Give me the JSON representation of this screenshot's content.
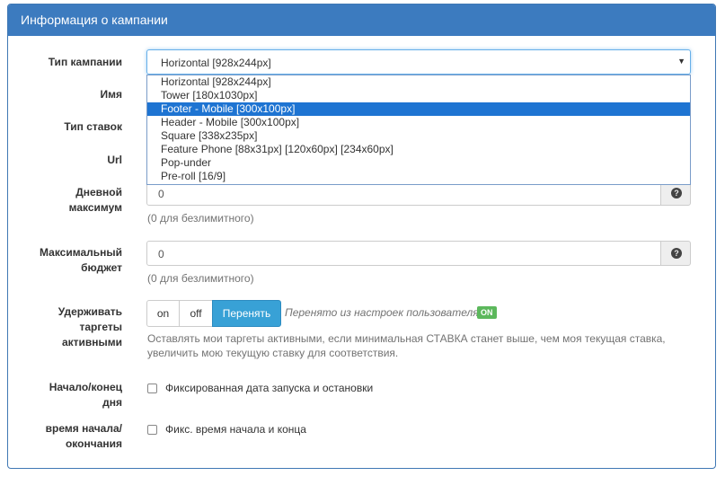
{
  "panel": {
    "title": "Информация о кампании"
  },
  "labels": {
    "campaign_type": "Тип кампании",
    "name": "Имя",
    "bid_type": "Тип ставок",
    "url": "Url",
    "daily_max_1": "Дневной",
    "daily_max_2": "максимум",
    "max_budget_1": "Максимальный",
    "max_budget_2": "бюджет",
    "keep_targets_1": "Удерживать",
    "keep_targets_2": "таргеты",
    "keep_targets_3": "активными",
    "start_end_1": "Начало/конец",
    "start_end_2": "дня",
    "time_1": "время начала/",
    "time_2": "окончания"
  },
  "campaign_type": {
    "selected": "Horizontal [928x244px]",
    "options": [
      "Horizontal [928x244px]",
      "Tower [180x1030px]",
      "Footer - Mobile [300x100px]",
      "Header - Mobile [300x100px]",
      "Square [338x235px]",
      "Feature Phone [88x31px] [120x60px] [234x60px]",
      "Pop-under",
      "Pre-roll [16/9]"
    ],
    "highlighted_index": 2,
    "caret": "▼"
  },
  "daily_max": {
    "value": "0",
    "help": "(0 для безлимитного)",
    "icon": "question-icon",
    "icon_glyph": "?"
  },
  "max_budget": {
    "value": "0",
    "help": "(0 для безлимитного)",
    "icon": "question-icon",
    "icon_glyph": "?"
  },
  "keep_targets": {
    "options": [
      "on",
      "off",
      "Перенять"
    ],
    "active": "Перенять",
    "inherited_text": "Перенято из настроек пользователя",
    "badge": "ON",
    "badge_color": "#5cb85c",
    "help_line1": "Оставлять мои таргеты активными, если минимальная СТАВКА станет выше, чем моя текущая ставка,",
    "help_line2": "увеличить мою текущую ставку для соответствия."
  },
  "start_end": {
    "checkbox_label": "Фиксированная дата запуска и остановки",
    "checked": false
  },
  "time": {
    "checkbox_label": "Фикс. время начала и конца",
    "checked": false
  },
  "colors": {
    "header": "#3c7bbf",
    "highlight": "#1e74d2",
    "active_button": "#38a1d6"
  }
}
